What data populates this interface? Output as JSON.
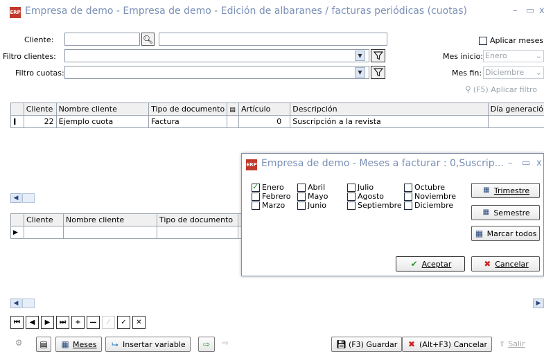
{
  "window": {
    "title": "Empresa de demo - Empresa de demo - Edición de albaranes / facturas periódicas (cuotas)",
    "logo": "ERP"
  },
  "filters": {
    "cliente_label": "Cliente:",
    "filtro_clientes_label": "Filtro clientes:",
    "filtro_cuotas_label": "Filtro cuotas:",
    "aplicar_meses_label": "Aplicar meses",
    "mes_inicio_label": "Mes inicio:",
    "mes_inicio_value": "Enero",
    "mes_fin_label": "Mes fin:",
    "mes_fin_value": "Diciembre",
    "aplicar_filtro_label": "(F5) Aplicar filtro"
  },
  "top_grid": {
    "headers": [
      "Cliente",
      "Nombre cliente",
      "Tipo de documento",
      "",
      "Artículo",
      "Descripción",
      "Día generación"
    ],
    "rows": [
      [
        "22",
        "Ejemplo cuota",
        "Factura",
        "",
        "0",
        "Suscripción a la revista",
        ""
      ]
    ]
  },
  "bottom_grid": {
    "headers": [
      "Cliente",
      "Nombre cliente",
      "Tipo de documento"
    ]
  },
  "toolbar": {
    "meses_label": "Meses",
    "insertar_variable_label": "Insertar variable",
    "guardar_label": "(F3) Guardar",
    "cancelar_label": "(Alt+F3) Cancelar",
    "salir_label": "Salir"
  },
  "dialog": {
    "title": "Empresa de demo - Meses a facturar : 0,Suscrip...",
    "months": [
      {
        "label": "Enero",
        "checked": true
      },
      {
        "label": "Febrero",
        "checked": false
      },
      {
        "label": "Marzo",
        "checked": false
      },
      {
        "label": "Abril",
        "checked": false
      },
      {
        "label": "Mayo",
        "checked": false
      },
      {
        "label": "Junio",
        "checked": false
      },
      {
        "label": "Julio",
        "checked": false
      },
      {
        "label": "Agosto",
        "checked": false
      },
      {
        "label": "Septiembre",
        "checked": false
      },
      {
        "label": "Octubre",
        "checked": false
      },
      {
        "label": "Noviembre",
        "checked": false
      },
      {
        "label": "Diciembre",
        "checked": false
      }
    ],
    "trimestre_label": "Trimestre",
    "semestre_label": "Semestre",
    "marcar_todos_label": "Marcar todos",
    "aceptar_label": "Aceptar",
    "cancelar_label": "Cancelar"
  },
  "colors": {
    "title_text": "#7a8fb5",
    "accept_green": "#2e9a2e",
    "cancel_red": "#cc2222",
    "logo_red": "#c0392b"
  }
}
